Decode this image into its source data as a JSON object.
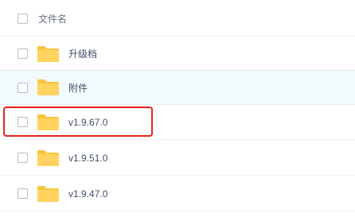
{
  "header": {
    "column_name_label": "文件名"
  },
  "files": [
    {
      "name": "升级档",
      "type_icon": "folder-icon"
    },
    {
      "name": "附件",
      "type_icon": "folder-icon"
    },
    {
      "name": "v1.9.67.0",
      "type_icon": "folder-icon"
    },
    {
      "name": "v1.9.51.0",
      "type_icon": "folder-icon"
    },
    {
      "name": "v1.9.47.0",
      "type_icon": "folder-icon"
    }
  ],
  "colors": {
    "folder": "#ffd35e",
    "folder_tab": "#f8c43f",
    "row_hover": "#f2fafd",
    "highlight": "#e3241b"
  }
}
